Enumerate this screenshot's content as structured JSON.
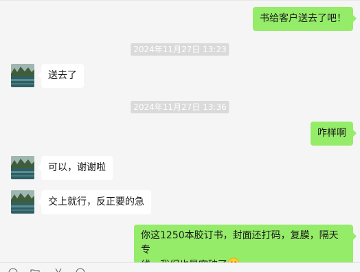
{
  "messages": [
    {
      "id": "m1",
      "direction": "out",
      "text": "书给客户送去了吧！"
    },
    {
      "id": "t1",
      "type": "timestamp",
      "text": "2024年11月27日 13:23"
    },
    {
      "id": "m2",
      "direction": "in",
      "avatar_icon": "lake-landscape-avatar",
      "text": "送去了"
    },
    {
      "id": "t2",
      "type": "timestamp",
      "text": "2024年11月27日 13:36"
    },
    {
      "id": "m3",
      "direction": "out",
      "text": "咋样啊"
    },
    {
      "id": "m4",
      "direction": "in",
      "avatar_icon": "lake-landscape-avatar",
      "text": "可以，谢谢啦"
    },
    {
      "id": "m5",
      "direction": "in",
      "avatar_icon": "lake-landscape-avatar",
      "text": "交上就行，反正要的急"
    },
    {
      "id": "m6",
      "direction": "out",
      "text_line1": "你这1250本胶订书，封面还打码，复膜，隔天专",
      "text_line2": "线，我们也是突破了",
      "emoji_icon": "grinning-face-emoji"
    }
  ],
  "colors": {
    "background": "#f5f5f5",
    "outgoing_bubble": "#95ec69",
    "incoming_bubble": "#ffffff",
    "timestamp_bg": "#dadada",
    "timestamp_text": "#ffffff"
  },
  "toolbar_icons": [
    "emoji-icon",
    "folder-icon",
    "scissors-icon",
    "chat-history-icon"
  ]
}
